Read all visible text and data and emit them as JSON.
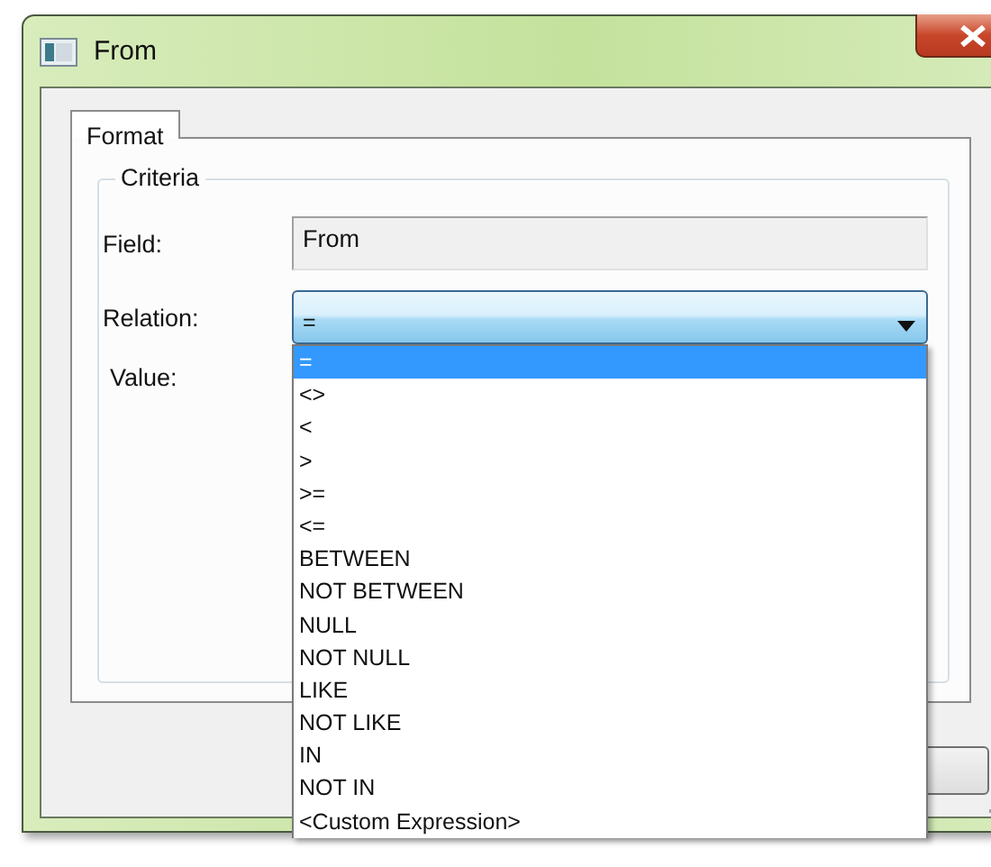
{
  "window": {
    "title": "From"
  },
  "tabs": [
    {
      "label": "Format",
      "selected": true
    }
  ],
  "group": {
    "title": "Criteria"
  },
  "fields": [
    {
      "label": "Field:",
      "kind": "readonly",
      "value": "From"
    },
    {
      "label": "Relation:",
      "kind": "combo",
      "value": "=",
      "expanded": true
    },
    {
      "label": "Value:",
      "kind": "hidden"
    }
  ],
  "dropdown": {
    "options": [
      {
        "label": "=",
        "selected": true
      },
      {
        "label": "<>",
        "selected": false
      },
      {
        "label": "<",
        "selected": false
      },
      {
        "label": ">",
        "selected": false
      },
      {
        "label": ">=",
        "selected": false
      },
      {
        "label": "<=",
        "selected": false
      },
      {
        "label": "BETWEEN",
        "selected": false
      },
      {
        "label": "NOT BETWEEN",
        "selected": false
      },
      {
        "label": "NULL",
        "selected": false
      },
      {
        "label": "NOT NULL",
        "selected": false
      },
      {
        "label": "LIKE",
        "selected": false
      },
      {
        "label": "NOT LIKE",
        "selected": false
      },
      {
        "label": "IN",
        "selected": false
      },
      {
        "label": "NOT IN",
        "selected": false
      },
      {
        "label": "<Custom Expression>",
        "selected": false
      }
    ]
  }
}
